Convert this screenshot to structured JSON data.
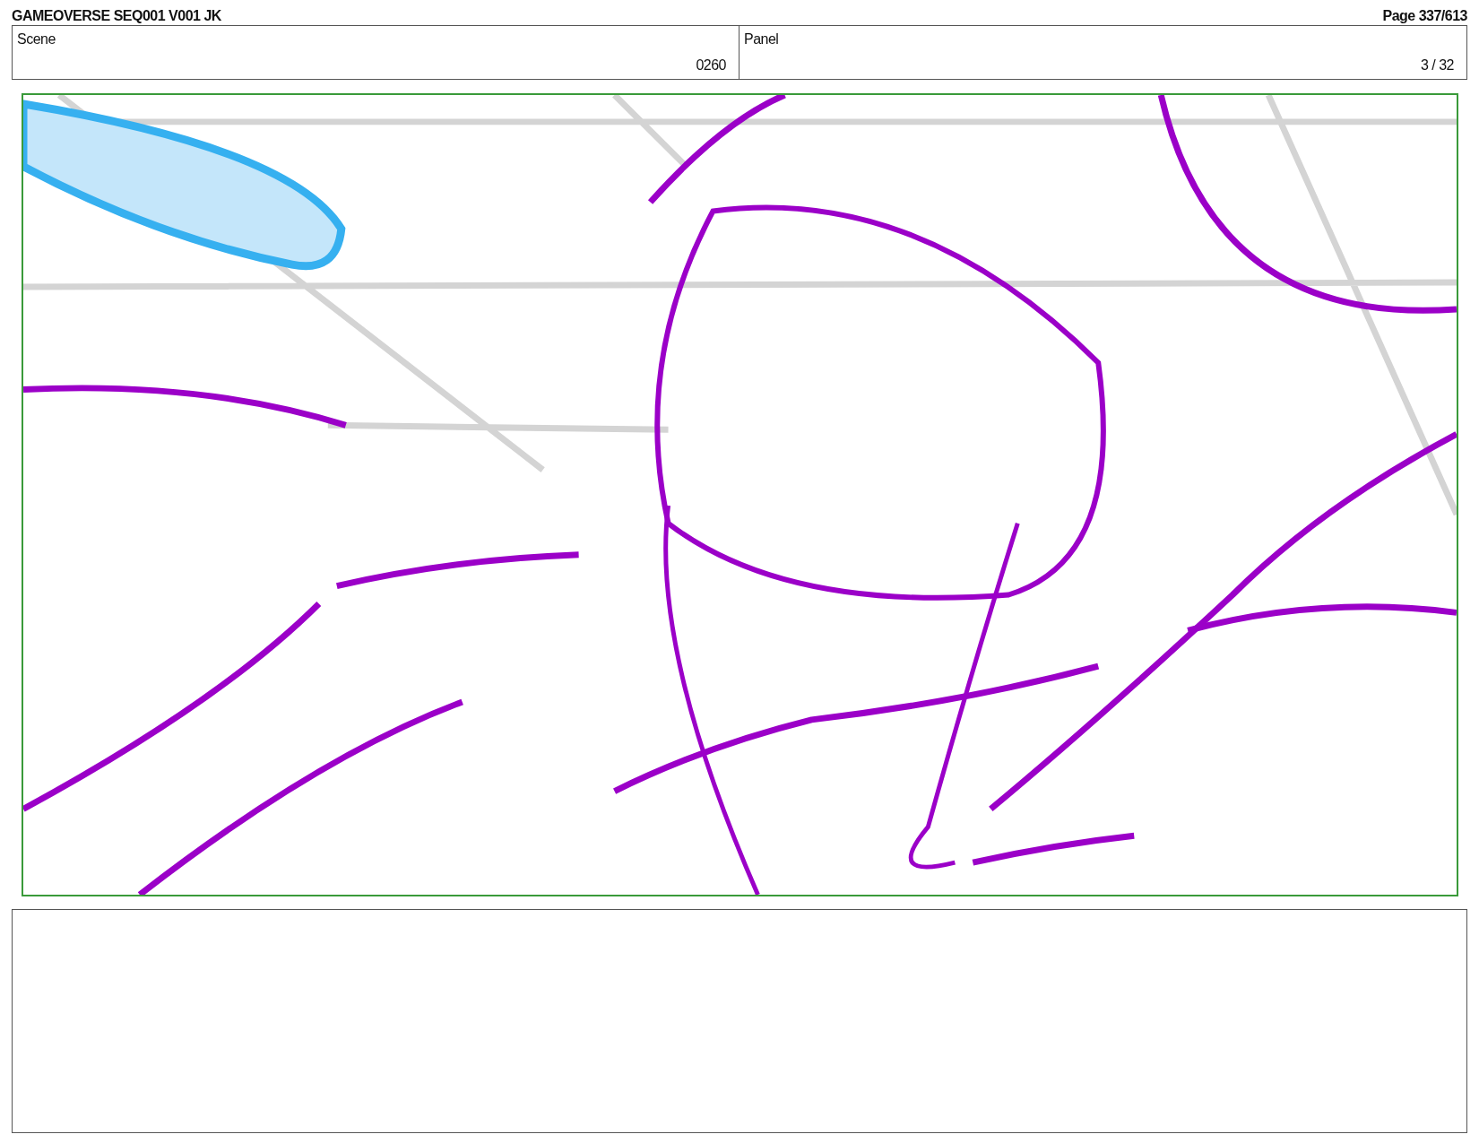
{
  "header": {
    "title": "GAMEOVERSE SEQ001 V001 JK",
    "page": "Page 337/613"
  },
  "fields": [
    {
      "label": "Scene",
      "value": "0260"
    },
    {
      "label": "Panel",
      "value": "3 / 32"
    }
  ]
}
